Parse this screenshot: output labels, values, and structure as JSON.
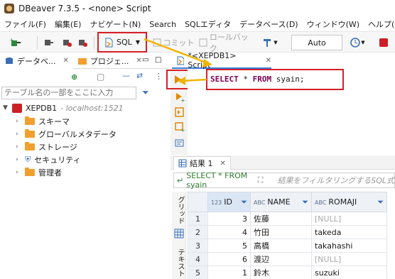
{
  "window": {
    "title": "DBeaver 7.3.5 - <none> Script"
  },
  "menu": [
    "ファイル(F)",
    "編集(E)",
    "ナビゲート(N)",
    "Search",
    "SQLエディタ",
    "データベース(D)",
    "ウィンドウ(W)",
    "ヘルプ(H)"
  ],
  "toolbar": {
    "sql_label": "SQL",
    "commit_label": "コミット",
    "rollback_label": "ロールバック",
    "tx_mode": "Auto"
  },
  "left_panel": {
    "tabs": [
      "データベ...",
      "プロジェ..."
    ],
    "filter_placeholder": "テーブル名の一部をここに入力",
    "connection": {
      "name": "XEPDB1",
      "host": "- localhost:1521"
    },
    "nodes": [
      "スキーマ",
      "グローバルメタデータ",
      "ストレージ",
      "セキュリティ",
      "管理者"
    ]
  },
  "editor": {
    "tab_label": "*<XEPDB1> Script",
    "sql": {
      "kw1": "SELECT",
      "star": " * ",
      "kw2": "FROM",
      "rest": " syain;"
    }
  },
  "results": {
    "tab_label": "結果 1",
    "query": "SELECT * FROM syain",
    "filter_hint": "結果をフィルタリングするSQL式",
    "side_labels": [
      "グリッド",
      "テキスト"
    ],
    "columns": [
      {
        "type": "123",
        "name": "ID"
      },
      {
        "type": "ABC",
        "name": "NAME"
      },
      {
        "type": "ABC",
        "name": "ROMAJI"
      }
    ],
    "rows": [
      {
        "n": "1",
        "id": "3",
        "name": "佐藤",
        "romaji": "[NULL]"
      },
      {
        "n": "2",
        "id": "4",
        "name": "竹田",
        "romaji": "takeda"
      },
      {
        "n": "3",
        "id": "5",
        "name": "高橋",
        "romaji": "takahashi"
      },
      {
        "n": "4",
        "id": "6",
        "name": "渡辺",
        "romaji": "[NULL]"
      },
      {
        "n": "5",
        "id": "1",
        "name": "鈴木",
        "romaji": "suzuki"
      }
    ]
  },
  "colors": {
    "accent_red": "#d81f26",
    "annotation_yellow": "#f0b400",
    "folder": "#f0a030"
  }
}
